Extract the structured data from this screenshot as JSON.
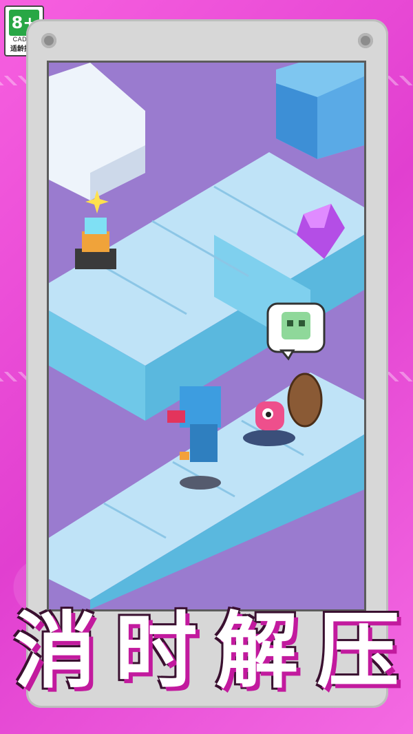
{
  "age_badge": {
    "rating": "8+",
    "org": "CADPA",
    "tip": "适龄提示"
  },
  "title": {
    "chars": [
      "消",
      "时",
      "解",
      "压"
    ]
  },
  "colors": {
    "background": "#f25ad8",
    "title_shadow": "#c21a9e",
    "tile": "#bfe3f7",
    "wall": "#6fc8e8",
    "floor": "#9d7fd0"
  },
  "icons": {
    "speech_bubble": "skull-speech-icon",
    "gem": "purple-gem-icon",
    "sparkle": "sparkle-icon",
    "shield": "wooden-shield-icon"
  }
}
